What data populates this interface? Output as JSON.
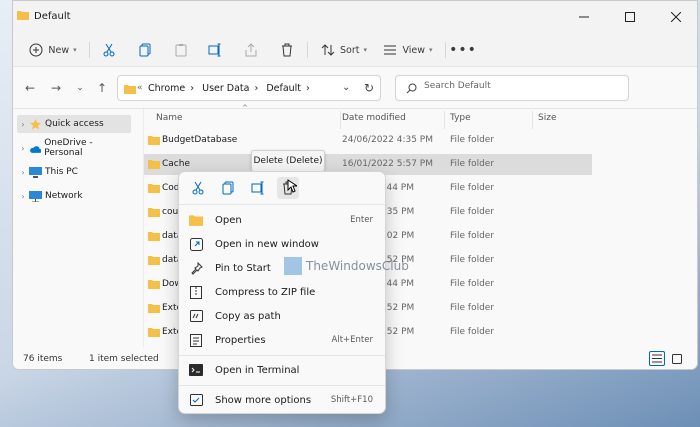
{
  "window": {
    "title": "Default"
  },
  "toolbar": {
    "new_label": "New",
    "sort_label": "Sort",
    "view_label": "View"
  },
  "address": {
    "crumbs": [
      "Chrome",
      "User Data",
      "Default"
    ],
    "search_placeholder": "Search Default"
  },
  "sidebar": {
    "items": [
      {
        "label": "Quick access",
        "icon": "star-icon"
      },
      {
        "label": "OneDrive - Personal",
        "icon": "cloud-icon"
      },
      {
        "label": "This PC",
        "icon": "computer-icon"
      },
      {
        "label": "Network",
        "icon": "network-icon"
      }
    ]
  },
  "columns": {
    "name": "Name",
    "date": "Date modified",
    "type": "Type",
    "size": "Size"
  },
  "rows": [
    {
      "name": "BudgetDatabase",
      "date": "24/06/2022 4:35 PM",
      "type": "File folder"
    },
    {
      "name": "Cache",
      "date": "16/01/2022 5:57 PM",
      "type": "File folder"
    },
    {
      "name": "Code",
      "date": "12:44 PM",
      "type": "File folder"
    },
    {
      "name": "coup",
      "date": "4:35 PM",
      "type": "File folder"
    },
    {
      "name": "data",
      "date": "3:02 PM",
      "type": "File folder"
    },
    {
      "name": "data",
      "date": "6:52 PM",
      "type": "File folder"
    },
    {
      "name": "Dow",
      "date": "12:44 PM",
      "type": "File folder"
    },
    {
      "name": "Exte",
      "date": "5:52 PM",
      "type": "File folder"
    },
    {
      "name": "Exte",
      "date": "6:52 PM",
      "type": "File folder"
    }
  ],
  "status": {
    "count": "76 items",
    "selected": "1 item selected"
  },
  "tooltip": "Delete (Delete)",
  "context_menu": {
    "items": [
      {
        "label": "Open",
        "accel": "Enter",
        "icon": "folder-icon"
      },
      {
        "label": "Open in new window",
        "accel": "",
        "icon": "open-window-icon"
      },
      {
        "label": "Pin to Start",
        "accel": "",
        "icon": "pin-icon"
      },
      {
        "label": "Compress to ZIP file",
        "accel": "",
        "icon": "zip-icon"
      },
      {
        "label": "Copy as path",
        "accel": "",
        "icon": "copy-path-icon"
      },
      {
        "label": "Properties",
        "accel": "Alt+Enter",
        "icon": "properties-icon"
      }
    ],
    "terminal": {
      "label": "Open in Terminal",
      "icon": "terminal-icon"
    },
    "more": {
      "label": "Show more options",
      "accel": "Shift+F10",
      "icon": "more-options-icon"
    }
  },
  "watermark": "TheWindowsClub",
  "colors": {
    "folder": "#f5c04a",
    "accent": "#0067c0",
    "selection": "#dcdcdc"
  }
}
